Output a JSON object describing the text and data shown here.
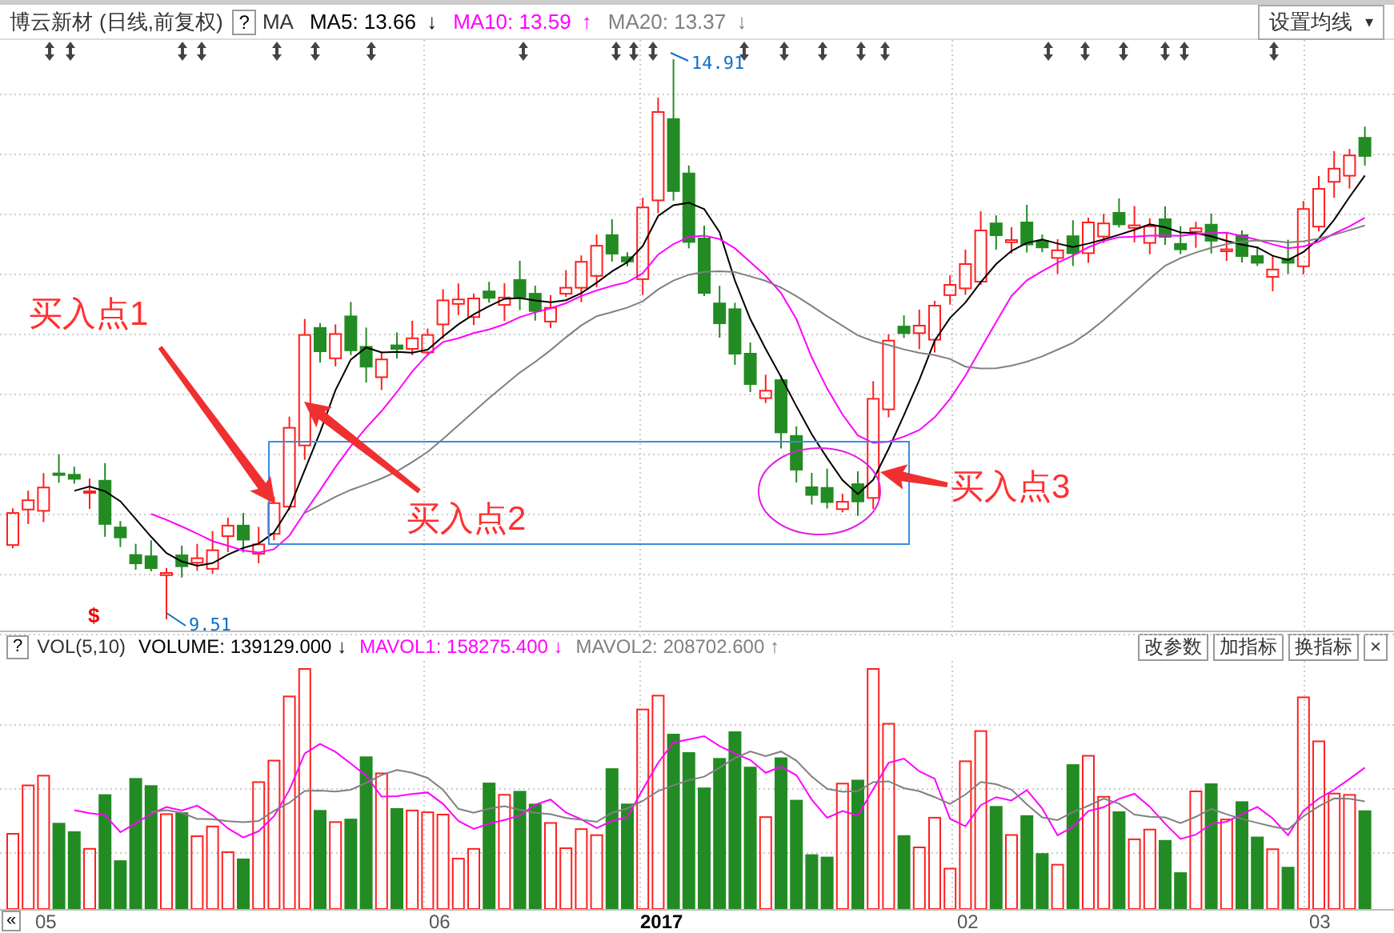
{
  "header": {
    "title": "博云新材",
    "mode": "(日线,前复权)",
    "help": "?",
    "indicator": "MA",
    "ma_lines": [
      {
        "label": "MA5: 13.66",
        "trend": "↓",
        "color": "#000000"
      },
      {
        "label": "MA10: 13.59",
        "trend": "↑",
        "color": "#ff00ff"
      },
      {
        "label": "MA20: 13.37",
        "trend": "↓",
        "color": "#808080"
      }
    ],
    "settings": "设置均线",
    "settings_caret": "▾"
  },
  "price_chart": {
    "high_label": "14.91",
    "low_label": "9.51",
    "signal_mark": "$",
    "annotations": [
      "买入点1",
      "买入点2",
      "买入点3"
    ]
  },
  "volume_header": {
    "help": "?",
    "indicator": "VOL(5,10)",
    "fields": [
      {
        "label": "VOLUME: 139129.000",
        "trend": "↓",
        "color": "#000000"
      },
      {
        "label": "MAVOL1: 158275.400",
        "trend": "↓",
        "color": "#ff00ff"
      },
      {
        "label": "MAVOL2: 208702.600",
        "trend": "↑",
        "color": "#808080"
      }
    ],
    "buttons": [
      "改参数",
      "加指标",
      "换指标"
    ],
    "close": "×"
  },
  "time_axis": {
    "back": "«",
    "labels": [
      {
        "text": "05",
        "bold": false
      },
      {
        "text": "06",
        "bold": false
      },
      {
        "text": "2017",
        "bold": true
      },
      {
        "text": "02",
        "bold": false
      },
      {
        "text": "03",
        "bold": false
      }
    ]
  }
}
